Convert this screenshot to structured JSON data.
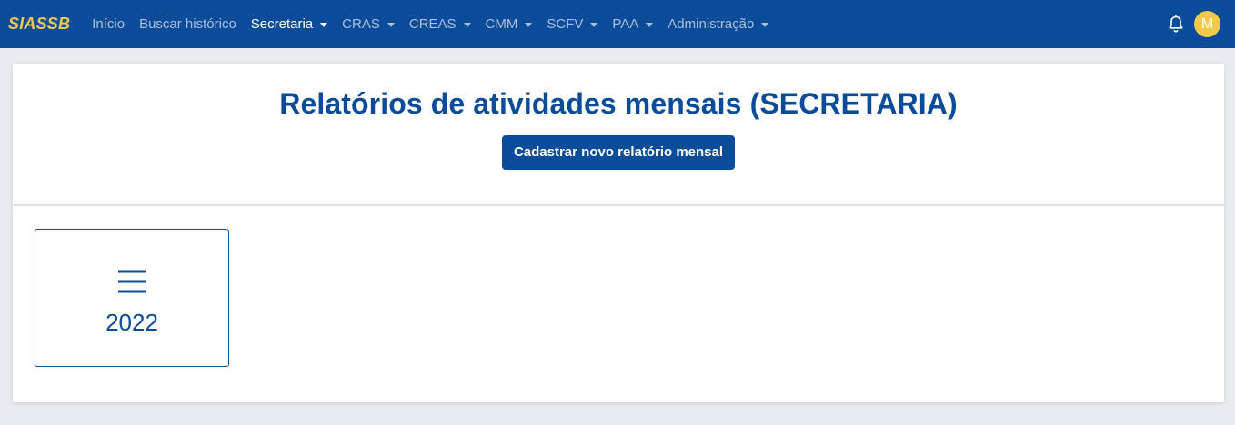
{
  "navbar": {
    "brand": "SIASSB",
    "items": [
      {
        "label": "Início",
        "dropdown": false,
        "active": false
      },
      {
        "label": "Buscar histórico",
        "dropdown": false,
        "active": false
      },
      {
        "label": "Secretaria",
        "dropdown": true,
        "active": true
      },
      {
        "label": "CRAS",
        "dropdown": true,
        "active": false
      },
      {
        "label": "CREAS",
        "dropdown": true,
        "active": false
      },
      {
        "label": "CMM",
        "dropdown": true,
        "active": false
      },
      {
        "label": "SCFV",
        "dropdown": true,
        "active": false
      },
      {
        "label": "PAA",
        "dropdown": true,
        "active": false
      },
      {
        "label": "Administração",
        "dropdown": true,
        "active": false
      }
    ],
    "notification_icon": "bell-icon",
    "avatar_initial": "M"
  },
  "page": {
    "title": "Relatórios de atividades mensais (SECRETARIA)",
    "new_report_button": "Cadastrar novo relatório mensal"
  },
  "years": [
    {
      "label": "2022",
      "icon": "list-icon"
    }
  ],
  "colors": {
    "primary": "#0b4c9a",
    "brand": "#f2c94c",
    "nav_text": "#aebfd8",
    "page_bg": "#e9ecef"
  }
}
